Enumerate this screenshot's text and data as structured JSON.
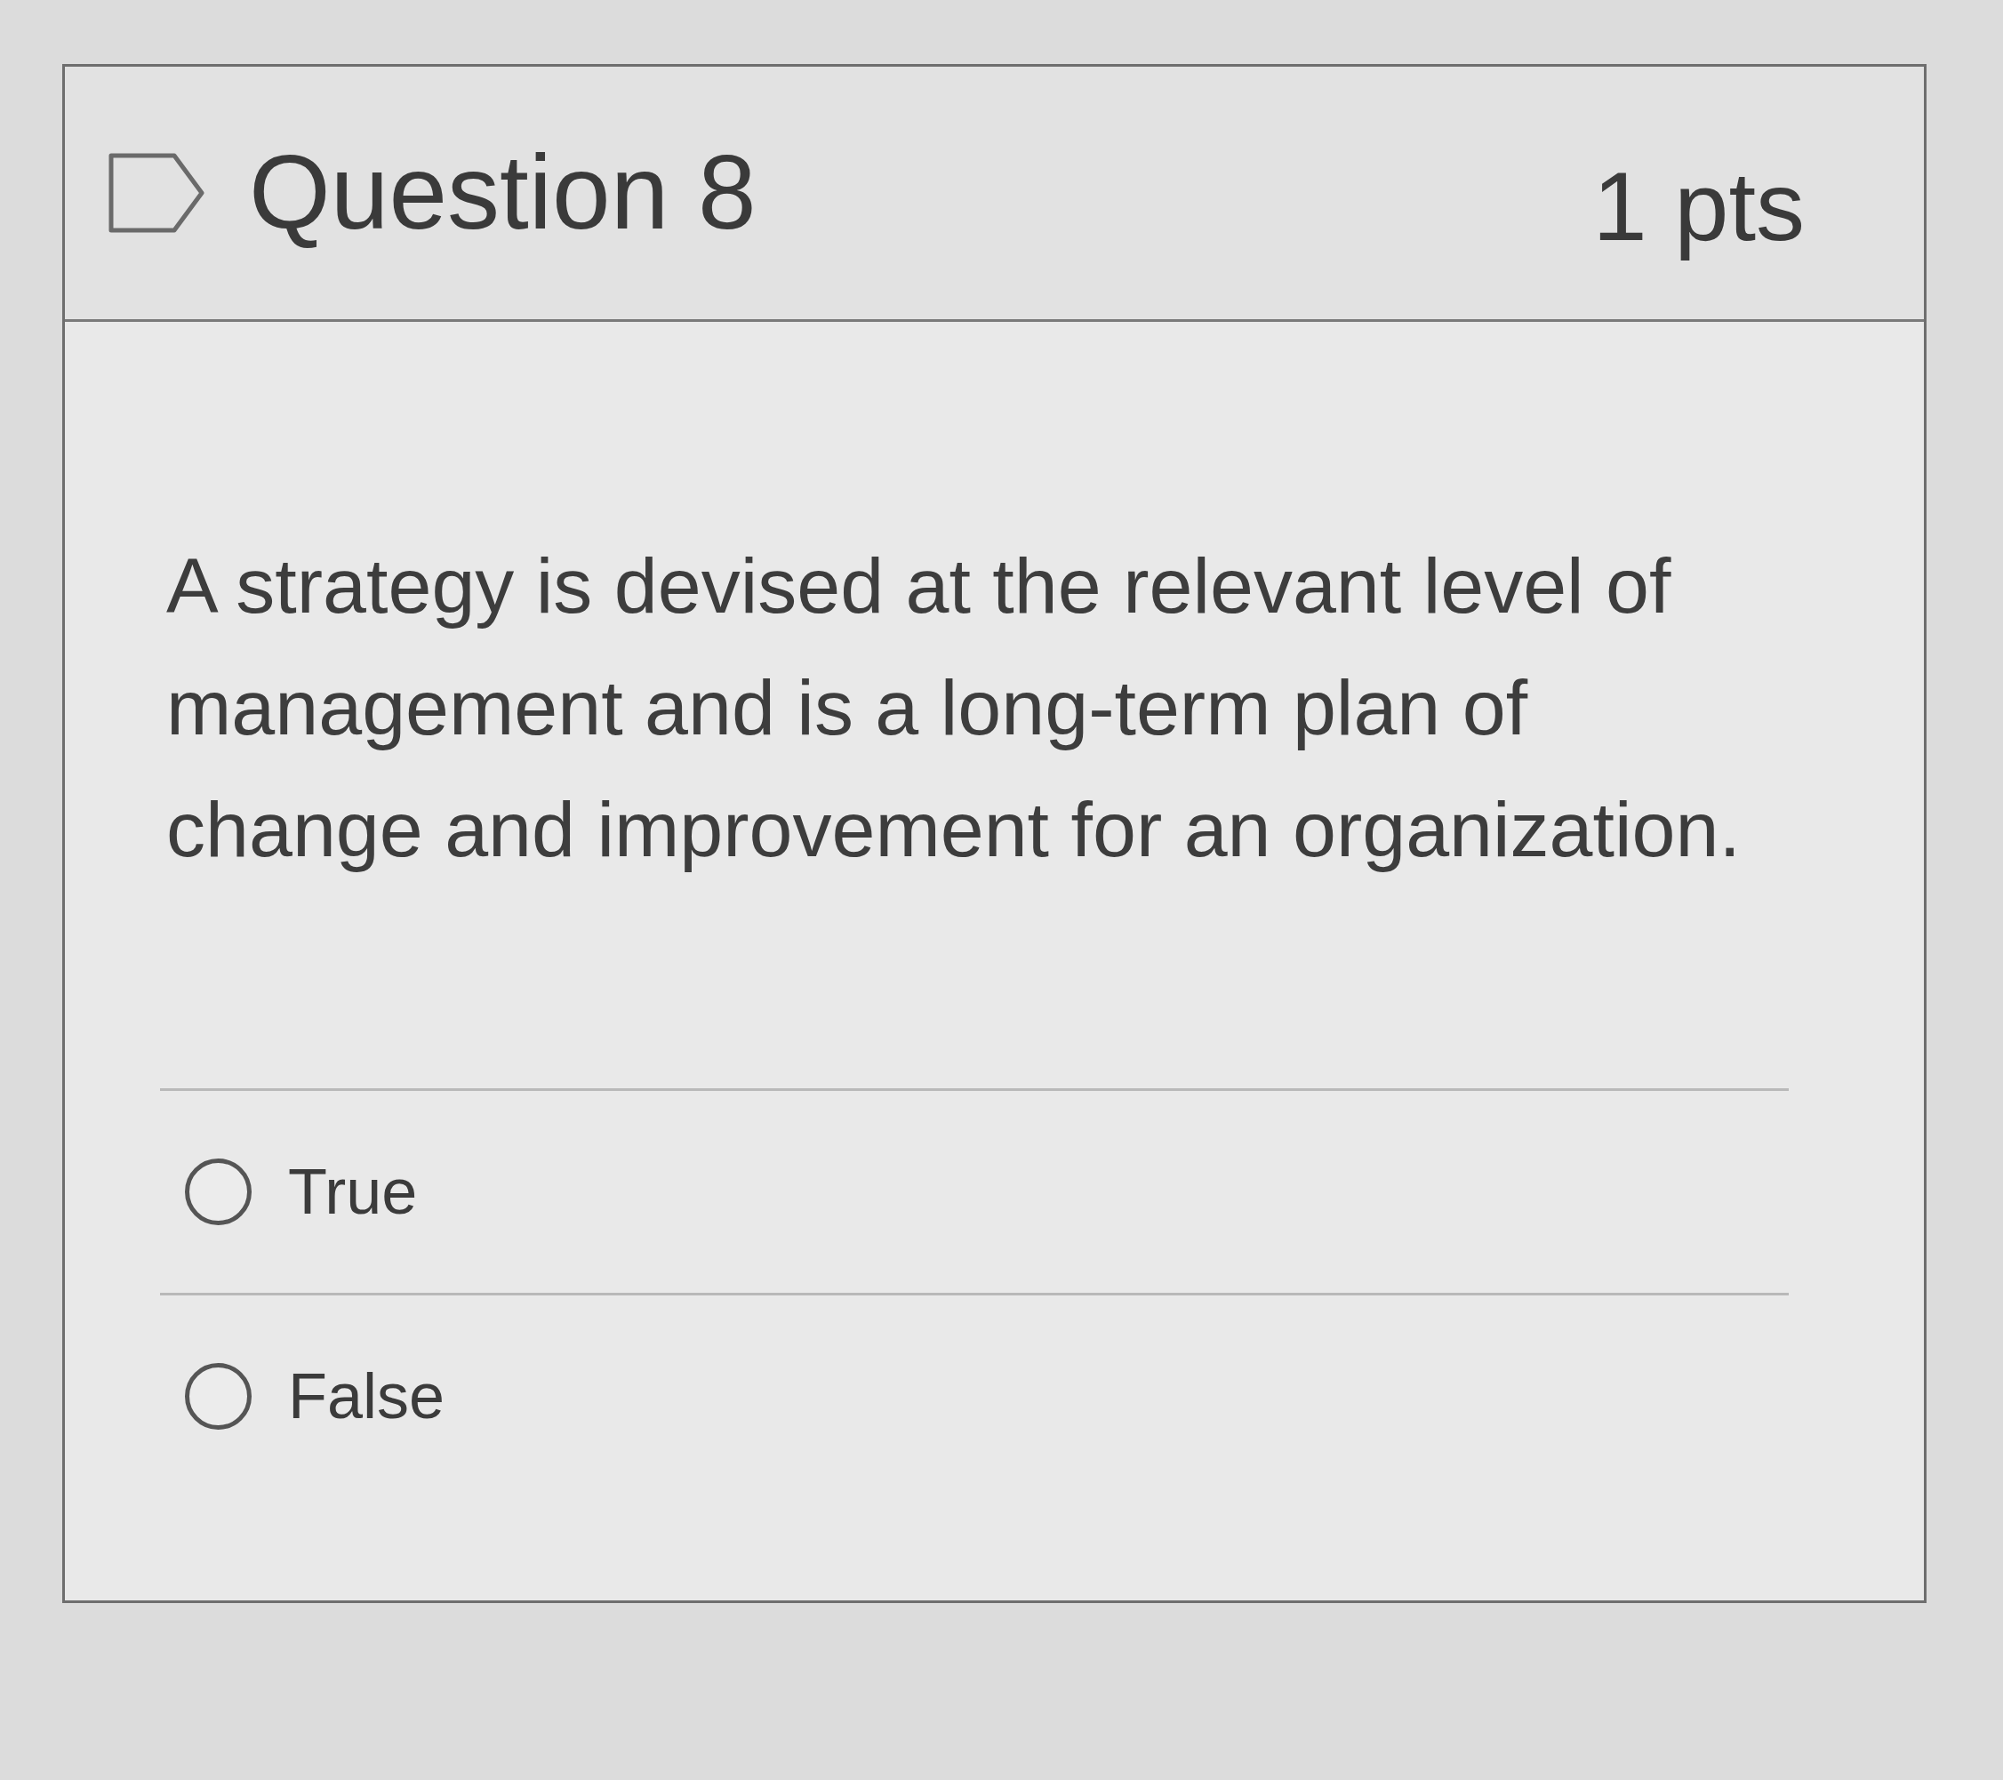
{
  "question": {
    "flagged": false,
    "title": "Question 8",
    "points": "1 pts",
    "text": "A strategy is devised at the relevant level of management and is a long-term plan of change and improvement for an organization."
  },
  "answers": [
    {
      "label": "True",
      "selected": false
    },
    {
      "label": "False",
      "selected": false
    }
  ]
}
